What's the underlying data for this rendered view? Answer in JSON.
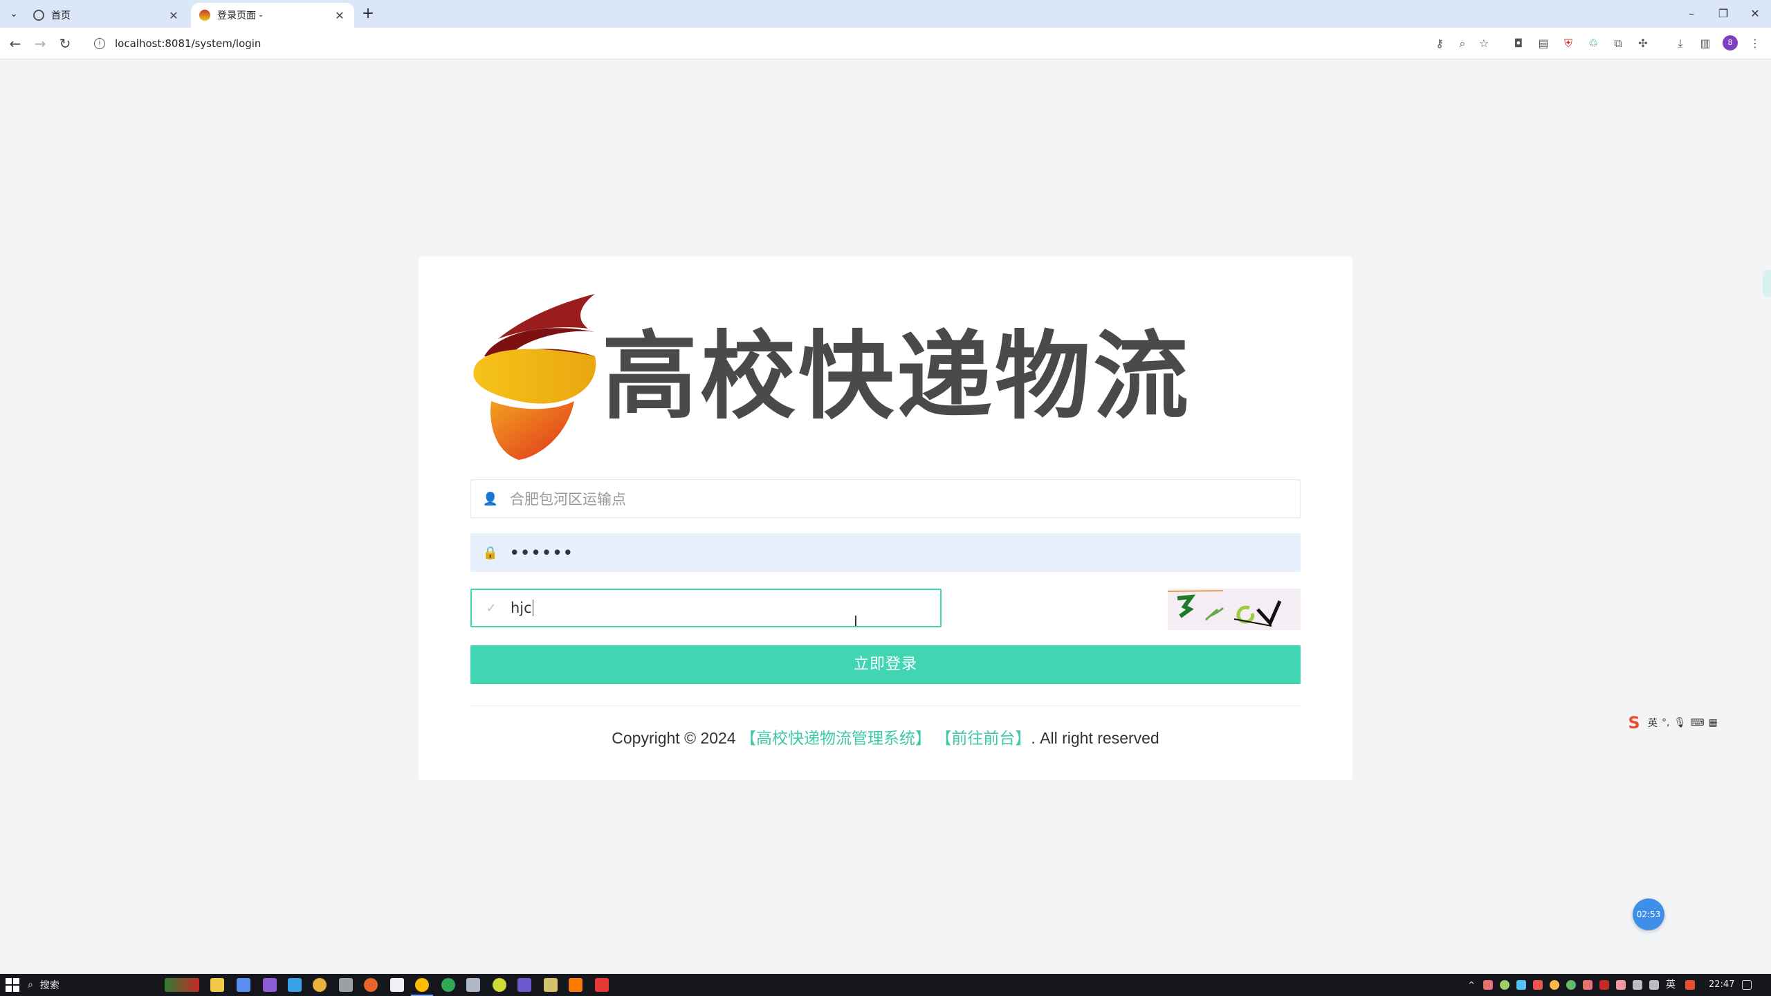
{
  "browser": {
    "tabs": [
      {
        "title": "首页",
        "active": false
      },
      {
        "title": "登录页面 -",
        "active": true
      }
    ],
    "url": "localhost:8081/system/login",
    "profile_initial": "8"
  },
  "logo": {
    "text": "高校快递物流"
  },
  "form": {
    "username_value": "合肥包河区运输点",
    "password_masked": "••••••",
    "captcha_value": "hjc",
    "login_button": "立即登录"
  },
  "footer": {
    "prefix": "Copyright © 2024",
    "system_link": "【高校快递物流管理系统】",
    "front_link": "【前往前台】",
    "suffix": ". All right reserved"
  },
  "ime": {
    "mode": "英",
    "punct": "°,"
  },
  "timer": "02:53",
  "taskbar": {
    "search_label": "搜索",
    "lang": "英",
    "time": "22:47"
  },
  "colors": {
    "accent": "#40d6b4",
    "link": "#40c9a9",
    "page_bg": "#f3f4f6"
  }
}
